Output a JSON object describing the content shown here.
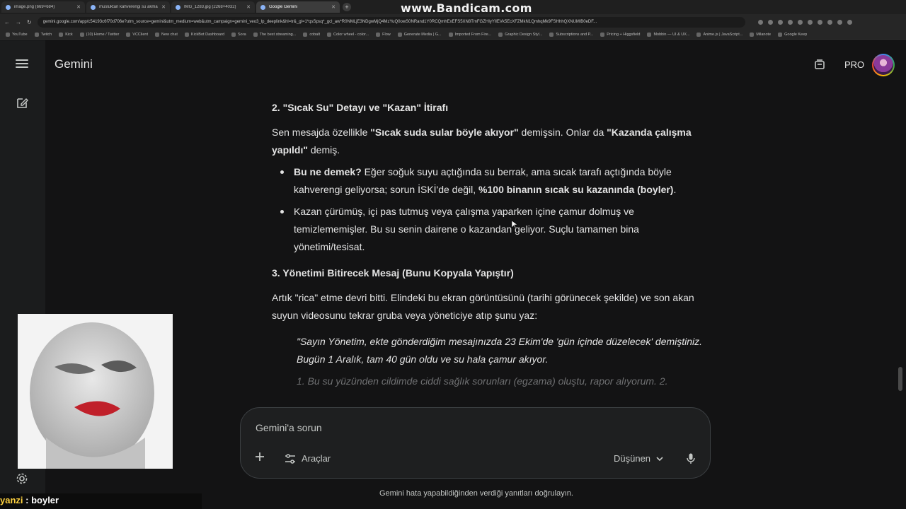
{
  "browser": {
    "tabs": [
      {
        "title": "image.png (669×684)",
        "active": false
      },
      {
        "title": "musluktan kahverengi su akması",
        "active": false
      },
      {
        "title": "IMG_1283.jpg (2268×4032)",
        "active": false
      },
      {
        "title": "Google Gemini",
        "active": true
      }
    ],
    "watermark": "www.Bandicam.com",
    "url": "gemini.google.com/app/c54193c6f70d706e?utm_source=gemini&utm_medium=web&utm_campaign=gemini_veo3_lp_deeplink&hl=tr&_gl=1*qsSpsq*_gcl_aw*R0NMLjE3NDgwMjQ4MzYuQ0owS0NRand1Y0RCQmhExEFS5XN8TmFGZHIyYlIEVk5EcXFZMkN1QmhqMk9FSHhhQXNUMlB0eDF...",
    "bookmarks": [
      "YouTube",
      "Twitch",
      "Kick",
      "(10) Home / Twitter",
      "VCClient",
      "New chat",
      "KickBot Dashboard",
      "Sora",
      "The best streaming...",
      "cobalt",
      "Color wheel - color...",
      "Flow",
      "Generate Media | G...",
      "Imported From Fire...",
      "Graphic Design Styl...",
      "Subscriptions and P...",
      "Pricing + Higgsfield",
      "Mobbin — UI & UX...",
      "Anime.js | JavaScript...",
      "Milanote",
      "Google Keep"
    ]
  },
  "app": {
    "brand": "Gemini",
    "plan": "PRO"
  },
  "response": {
    "section2": {
      "heading": "2. \"Sıcak Su\" Detayı ve \"Kazan\" İtirafı",
      "p1_a": "Sen mesajda özellikle ",
      "p1_b": "\"Sıcak suda sular böyle akıyor\"",
      "p1_c": " demişsin. Onlar da ",
      "p1_d": "\"Kazanda çalışma yapıldı\"",
      "p1_e": " demiş.",
      "bullet1_a": "Bu ne demek?",
      "bullet1_b": " Eğer soğuk suyu açtığında su berrak, ama sıcak tarafı açtığında böyle kahverengi geliyorsa; sorun İSKİ'de değil, ",
      "bullet1_c": "%100 binanın sıcak su kazanında (boyler)",
      "bullet1_d": ".",
      "bullet2": "Kazan çürümüş, içi pas tutmuş veya çalışma yaparken içine çamur dolmuş ve temizlememişler. Bu su senin dairene o kazandan geliyor. Suçlu tamamen bina yönetimi/tesisat."
    },
    "section3": {
      "heading": "3. Yönetimi Bitirecek Mesaj (Bunu Kopyala Yapıştır)",
      "p1": "Artık \"rica\" etme devri bitti. Elindeki bu ekran görüntüsünü (tarihi görünecek şekilde) ve son akan suyun videosunu tekrar gruba veya yöneticiye atıp şunu yaz:",
      "quote": "\"Sayın Yönetim, ekte gönderdiğim mesajınızda 23 Ekim'de 'gün içinde düzelecek' demiştiniz. Bugün 1 Aralık, tam 40 gün oldu ve su hala çamur akıyor.",
      "quote_faded": "1. Bu su yüzünden cildimde ciddi sağlık sorunları (egzama) oluştu, rapor alıyorum. 2."
    }
  },
  "composer": {
    "placeholder": "Gemini'a sorun",
    "tools_label": "Araçlar",
    "mode_label": "Düşünen"
  },
  "disclaimer": "Gemini hata yapabildiğinden verdiği yanıtları doğrulayın.",
  "overlay": {
    "chat_user": "yanzi",
    "chat_sep": " : ",
    "chat_msg": "boyler"
  }
}
